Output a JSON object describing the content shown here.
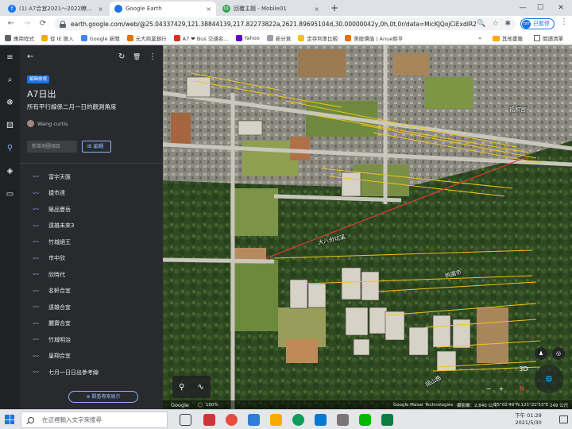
{
  "browser": {
    "tabs": [
      {
        "label": "(1) A7合宜2021～2022瞭望 | Fac",
        "favicon_color": "#1877f2",
        "favicon_glyph": "f"
      },
      {
        "label": "Google Earth",
        "favicon_color": "#1a73e8",
        "favicon_glyph": ""
      },
      {
        "label": "回覆主題 - Mobile01",
        "favicon_color": "#34a853",
        "favicon_glyph": "01"
      }
    ],
    "close_glyph": "×",
    "new_tab_glyph": "+",
    "window_controls": {
      "minimize": "—",
      "maximize": "☐",
      "close": "✕"
    },
    "nav": {
      "back": "←",
      "forward": "→",
      "reload": "⟳"
    },
    "url": "earth.google.com/web/@25.04337429,121.38844139,217.82273822a,2621.89695104d,30.00000042y,0h,0t,0r/data=MicKJQojCiExdIR2S...",
    "omnibox_icons": [
      "🔍",
      "☆",
      "✱"
    ],
    "profile": {
      "avatar_text": "tzir",
      "status": "已暫停"
    },
    "menu_glyph": "⋮"
  },
  "bookmarks": {
    "items": [
      {
        "label": "應用程式",
        "color": "#5f6368"
      },
      {
        "label": "從 IE 匯入",
        "color": "#f9ab00"
      },
      {
        "label": "Google 新聞",
        "color": "#4285f4"
      },
      {
        "label": "元大商業銀行",
        "color": "#e37400"
      },
      {
        "label": "A7 ❤ Bus 交通名...",
        "color": "#d93025"
      },
      {
        "label": "Yahoo",
        "color": "#6001d2"
      },
      {
        "label": "新分頁",
        "color": "#9aa0a6"
      },
      {
        "label": "定存利率比較",
        "color": "#f6c026"
      },
      {
        "label": "美股慣值 | Anue鉅亨",
        "color": "#e8710a"
      }
    ],
    "more": "»",
    "other": "其他書籤",
    "reading": "閱讀清單"
  },
  "earth": {
    "rail_icons": [
      "menu-icon",
      "search-icon",
      "voyager-icon",
      "dice-icon",
      "projects-icon",
      "layers-icon",
      "measure-icon"
    ],
    "rail_glyphs": [
      "≡",
      "⌕",
      "☸",
      "⚄",
      "⚲",
      "◈",
      "▭"
    ],
    "panel_top": {
      "back": "←",
      "present": "↻",
      "delete": "🗑",
      "more": "⋮"
    },
    "project": {
      "chip": "編輯檢視",
      "title": "A7日出",
      "description": "所有平行線係二月一日的觀測角度",
      "author": "Wang curtis",
      "add_placeholder": "新增地圖項目",
      "edit_label": "編輯",
      "present_label": "觀看專案展示"
    },
    "items": [
      "富宇天匯",
      "捷市達",
      "築品豐岳",
      "遠雄未來3",
      "竹城絕王",
      "市中欣",
      "欣時代",
      "名軒合宜",
      "遠雄合宜",
      "麗寶合宜",
      "竹城明治",
      "皇翔合宜",
      "七月一日日出參考線"
    ],
    "map_labels": {
      "temple": "福和宮",
      "road": "大八份坑溪",
      "river": "桃園市",
      "road2": "岡山路"
    },
    "map_tools": {
      "pin": "⚲",
      "path": "∿"
    },
    "status": {
      "logo": "Google",
      "zoom": "100%",
      "attribution": "Google  Maxar Technologies",
      "camera": "攝影機：2,840 公尺",
      "coords": "25°02'49\"N 121°22'53\"E",
      "elevation": "249 公尺"
    },
    "controls": {
      "mode_3d": "3D",
      "compass": "N",
      "zoom_in": "+",
      "zoom_out": "−",
      "pegman": "♟",
      "locate": "◎"
    }
  },
  "taskbar": {
    "search_placeholder": "在這裡輸入文字來搜尋",
    "time": "下午 01:29",
    "date": "2021/5/30"
  }
}
